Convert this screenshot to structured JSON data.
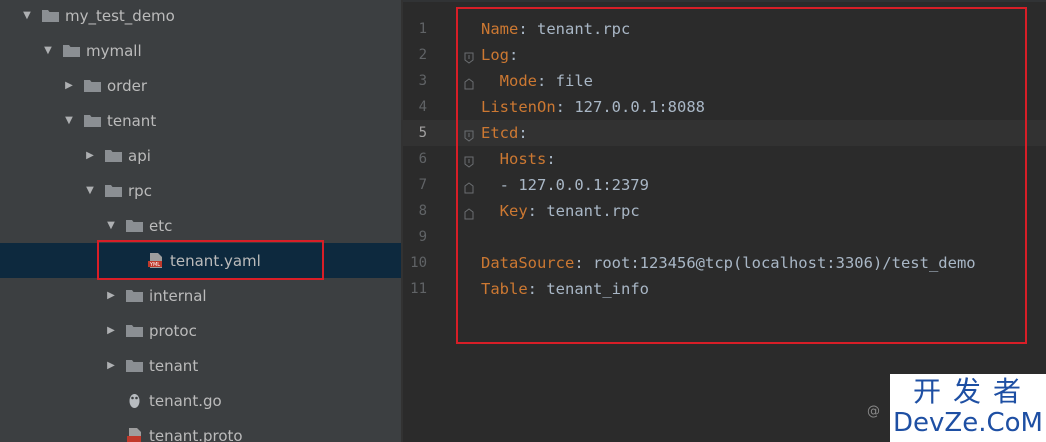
{
  "tree": {
    "items": [
      {
        "label": "my_test_demo",
        "kind": "folder",
        "expanded": true,
        "depth": 0
      },
      {
        "label": "mymall",
        "kind": "folder",
        "expanded": true,
        "depth": 1
      },
      {
        "label": "order",
        "kind": "folder",
        "expanded": false,
        "depth": 2
      },
      {
        "label": "tenant",
        "kind": "folder",
        "expanded": true,
        "depth": 2
      },
      {
        "label": "api",
        "kind": "folder",
        "expanded": false,
        "depth": 3
      },
      {
        "label": "rpc",
        "kind": "folder",
        "expanded": true,
        "depth": 3
      },
      {
        "label": "etc",
        "kind": "folder",
        "expanded": true,
        "depth": 4
      },
      {
        "label": "tenant.yaml",
        "kind": "yaml-file",
        "selected": true,
        "depth": 5
      },
      {
        "label": "internal",
        "kind": "folder",
        "expanded": false,
        "depth": 4
      },
      {
        "label": "protoc",
        "kind": "folder",
        "expanded": false,
        "depth": 4
      },
      {
        "label": "tenant",
        "kind": "folder",
        "expanded": false,
        "depth": 4
      },
      {
        "label": "tenant.go",
        "kind": "go-file",
        "depth": 4
      },
      {
        "label": "tenant.proto",
        "kind": "proto-file",
        "depth": 4
      }
    ]
  },
  "editor": {
    "current_line": 5,
    "lines": [
      {
        "n": "1",
        "key": "Name",
        "rest": " tenant.rpc"
      },
      {
        "n": "2",
        "key": "Log",
        "rest": ""
      },
      {
        "n": "3",
        "key": "  Mode",
        "rest": " file"
      },
      {
        "n": "4",
        "key": "ListenOn",
        "rest": " 127.0.0.1:8088"
      },
      {
        "n": "5",
        "key": "Etcd",
        "rest": ""
      },
      {
        "n": "6",
        "key": "  Hosts",
        "rest": ""
      },
      {
        "n": "7",
        "key": "",
        "rest": "  - 127.0.0.1:2379"
      },
      {
        "n": "8",
        "key": "  Key",
        "rest": " tenant.rpc"
      },
      {
        "n": "9",
        "key": "",
        "rest": ""
      },
      {
        "n": "10",
        "key": "DataSource",
        "rest": " root:123456@tcp(localhost:3306)/test_demo"
      },
      {
        "n": "11",
        "key": "Table",
        "rest": " tenant_info"
      }
    ]
  },
  "watermark": {
    "top": "开发者",
    "bottom": "DevZe.CoM",
    "at": "@"
  },
  "colors": {
    "highlight_box": "#d81e27",
    "key": "#cc7832",
    "text": "#a9b7c6",
    "folder": "#8b8f93",
    "selected_row": "#0d293e"
  }
}
